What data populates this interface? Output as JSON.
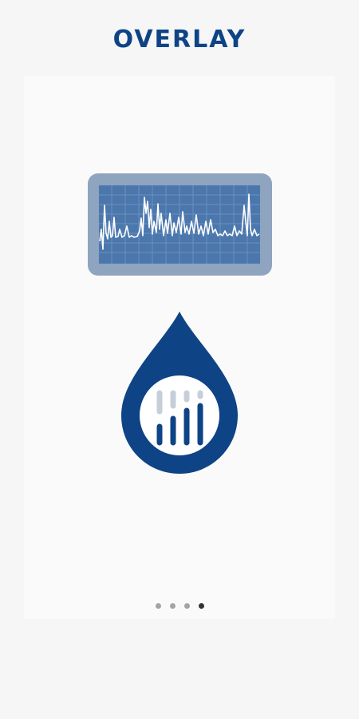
{
  "title": "OVERLAY",
  "illustration": {
    "monitor_icon": "waveform-monitor-icon",
    "drop_icon": "water-drop-bars-icon"
  },
  "pager": {
    "count": 4,
    "active_index": 3
  },
  "colors": {
    "brand": "#0e4486",
    "monitor_frame": "#8ea4bf",
    "monitor_screen": "#4b77ad",
    "bars_light": "#c6cfd9",
    "background": "#f6f6f7"
  }
}
